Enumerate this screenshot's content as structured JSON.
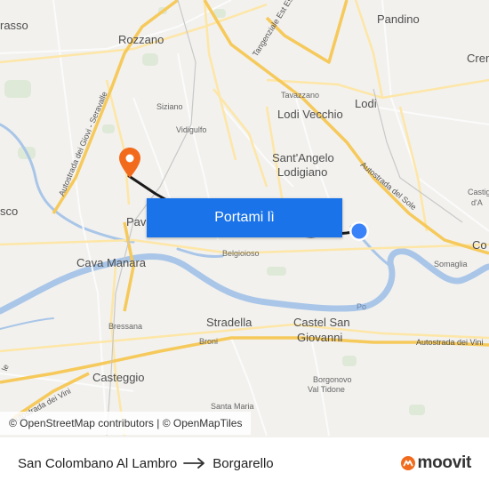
{
  "map": {
    "labels": {
      "pandino": "Pandino",
      "crema": "Crem",
      "rozzano": "Rozzano",
      "abbiategrasso": "rasso",
      "tangenziale": "Tangenziale Est Esterna di",
      "tavazzano": "Tavazzano",
      "lodi_vecchio": "Lodi Vecchio",
      "lodi": "Lodi",
      "siziano": "Siziano",
      "vidigulfo": "Vidigulfo",
      "santangelo1": "Sant'Angelo",
      "santangelo2": "Lodigiano",
      "giovi": "Autostrada dei Giovi - Seravalle",
      "autostrada_sole": "Autostrada del Sole",
      "castiglione1": "Castig",
      "castiglione2": "d'A",
      "co": "Co",
      "somaglia": "Somaglia",
      "sco": "sco",
      "pavia": "Pavia",
      "cava_manara": "Cava Manara",
      "belgioioso": "Belgioioso",
      "po": "Po",
      "stradella": "Stradella",
      "castel1": "Castel San",
      "castel2": "Giovanni",
      "autostrada_vini_right": "Autostrada dei Vini",
      "bressana": "Bressana",
      "broni": "Broni",
      "autostrada_vini_left": "Autostrada dei Vini",
      "casteggio": "Casteggio",
      "borgonovo1": "Borgonovo",
      "borgonovo2": "Val Tidone",
      "santa_maria": "Santa Maria",
      "le": "le"
    },
    "cta_label": "Portami lì",
    "attribution": "© OpenStreetMap contributors | © OpenMapTiles",
    "colors": {
      "water": "#a9c6e8",
      "route": "#1a1a1a",
      "destination_pin": "#f26b1d",
      "origin_dot": "#3a82f7",
      "button": "#1a73e8"
    }
  },
  "footer": {
    "origin": "San Colombano Al Lambro",
    "destination": "Borgarello",
    "brand": "moovit",
    "brand_color": "#f26b1d"
  }
}
